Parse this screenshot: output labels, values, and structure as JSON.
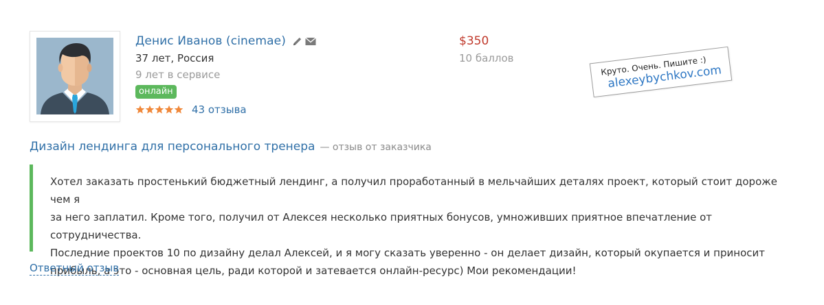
{
  "user": {
    "name": "Денис Иванов (cinemae)",
    "age_location": "37 лет, Россия",
    "service_years": "9 лет в сервисе",
    "status_badge": "онлайн",
    "rating_stars": 5,
    "reviews_count": "43 отзыва"
  },
  "price": {
    "amount": "$350",
    "points": "10 баллов"
  },
  "stamp": {
    "line1": "Круто. Очень. Пишите :)",
    "line2": "alexeybychkov.com"
  },
  "review": {
    "project_title": "Дизайн лендинга для персонального тренера",
    "source": "— отзыв от заказчика",
    "text": "Хотел заказать простенький бюджетный лендинг, а получил проработанный в мельчайших деталях проект, который стоит дороже чем я\nза него заплатил. Кроме того, получил от Алексея несколько приятных бонусов, умноживших приятное впечатление от сотрудничества.\nПоследние проектов 10 по дизайну делал Алексей, и я могу сказать уверенно - он делает дизайн, который окупается и приносит\nприбыль, а это - основная цель, ради которой и затевается онлайн-ресурс) Мои рекомендации!",
    "reply_link": "Ответный отзыв"
  },
  "icons": {
    "edit": "pencil-icon",
    "mail": "envelope-icon",
    "star": "star-icon"
  },
  "colors": {
    "link": "#2f6fa7",
    "price": "#c0392b",
    "online": "#5cb85c",
    "accent_border": "#5cb85c",
    "star": "#f0883a"
  }
}
